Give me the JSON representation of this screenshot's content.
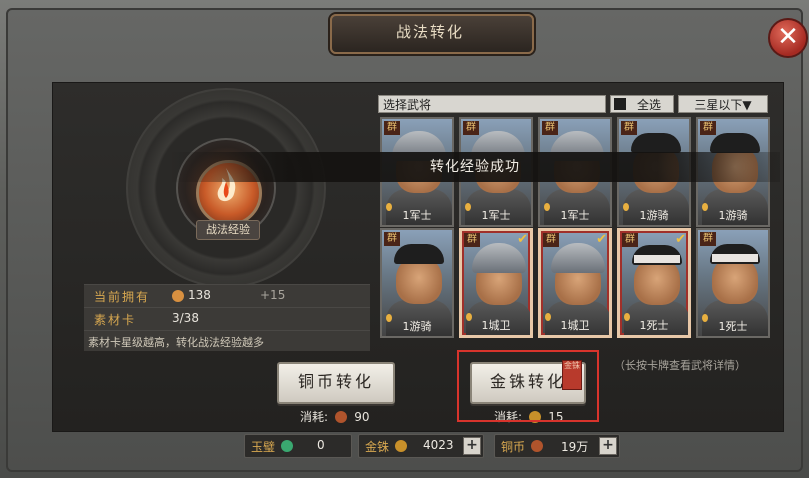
{
  "title": "战法转化",
  "close_icon": "close-x-icon",
  "left_panel": {
    "exp_label": "战法经验",
    "current_label": "当前拥有",
    "current_value": "138",
    "current_gain": "+15",
    "material_label": "素材卡",
    "material_value": "3/38",
    "hint": "素材卡星级越高，转化战法经验越多"
  },
  "select_header": {
    "select_label": "选择武将",
    "all_label": "全选",
    "filter_label": "三星以下▼"
  },
  "toast": "转化经验成功",
  "cards": [
    {
      "faction": "群",
      "name": "1军士",
      "selected": false,
      "type": "helmet"
    },
    {
      "faction": "群",
      "name": "1军士",
      "selected": false,
      "type": "helmet"
    },
    {
      "faction": "群",
      "name": "1军士",
      "selected": false,
      "type": "helmet"
    },
    {
      "faction": "群",
      "name": "1游骑",
      "selected": false,
      "type": "cloth"
    },
    {
      "faction": "群",
      "name": "1游骑",
      "selected": false,
      "type": "cloth"
    },
    {
      "faction": "群",
      "name": "1游骑",
      "selected": false,
      "type": "cloth"
    },
    {
      "faction": "群",
      "name": "1城卫",
      "selected": true,
      "type": "helmet"
    },
    {
      "faction": "群",
      "name": "1城卫",
      "selected": true,
      "type": "helmet"
    },
    {
      "faction": "群",
      "name": "1死士",
      "selected": true,
      "type": "band"
    },
    {
      "faction": "群",
      "name": "1死士",
      "selected": false,
      "type": "band"
    }
  ],
  "buttons": {
    "copper_convert": "铜币转化",
    "gold_convert": "金铢转化",
    "cost_label": "消耗:",
    "copper_cost": "90",
    "gold_cost": "15",
    "seal_text": "金铢"
  },
  "longpress_hint": "（长按卡牌查看武将详情）",
  "currency": {
    "jade_label": "玉璧",
    "jade_value": "0",
    "gold_label": "金铢",
    "gold_value": "4023",
    "copper_label": "铜币",
    "copper_value": "19万"
  },
  "colors": {
    "accent_gold": "#d8a850",
    "highlight_red": "#d8342c",
    "jade": "#3aa870",
    "gold_coin": "#c8902a",
    "copper_coin": "#b0542c"
  }
}
